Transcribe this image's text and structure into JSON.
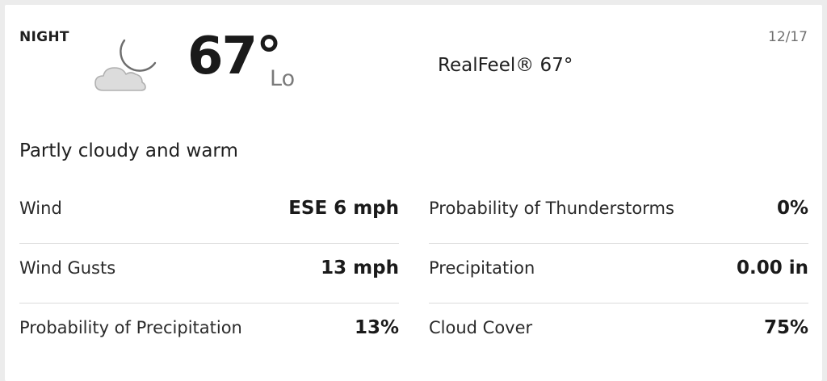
{
  "header": {
    "period": "NIGHT",
    "date": "12/17",
    "icon": "partly-cloudy-night-icon",
    "temperature": "67°",
    "temperature_suffix": "Lo",
    "realfeel": "RealFeel® 67°"
  },
  "phrase": "Partly cloudy and warm",
  "details_left": [
    {
      "label": "Wind",
      "value": "ESE 6 mph"
    },
    {
      "label": "Wind Gusts",
      "value": "13 mph"
    },
    {
      "label": "Probability of Precipitation",
      "value": "13%"
    }
  ],
  "details_right": [
    {
      "label": "Probability of Thunderstorms",
      "value": "0%"
    },
    {
      "label": "Precipitation",
      "value": "0.00 in"
    },
    {
      "label": "Cloud Cover",
      "value": "75%"
    }
  ]
}
